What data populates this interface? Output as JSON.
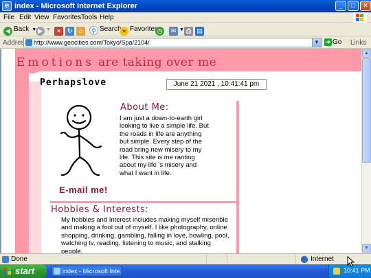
{
  "window": {
    "title": "index - Microsoft Internet Explorer",
    "app_icon": "e",
    "controls": {
      "minimize": "_",
      "maximize": "□",
      "close": "×"
    }
  },
  "menu": [
    "File",
    "Edit",
    "View",
    "Favorites",
    "Tools",
    "Help"
  ],
  "toolbar": {
    "back_label": "Back",
    "search_label": "Search",
    "favorites_label": "Favorites"
  },
  "address": {
    "label": "Address",
    "url": "http://www.geocities.com/Tokyo/Spa/2104/",
    "go_label": "Go",
    "links_label": "Links"
  },
  "page": {
    "headline_spaced": "Emotions",
    "headline_rest": "are taking over me",
    "site_name": "Perhapslove",
    "datetime": "June 21 2021 , 10:41:41 pm",
    "email_label": "E-mail me!",
    "about": {
      "title": "About Me:",
      "text": "I am just a down-to-earth girl looking to live a simple life. But the roads in life are anything but simple.  Every step of the road bring new misery to my life. This site is me ranting about my life 's misery and what I want in life."
    },
    "hobbies": {
      "title": "Hobbies & Interests:",
      "text": "My hobbies and Interest includes making myself miserible and making a fool out of myself. I like photography, online shopping, drinking, gambling, falling in love, bowling, pool, watching tv, reading, listening to music, and stalking people."
    }
  },
  "status": {
    "text": "Done",
    "zone": "Internet"
  },
  "taskbar": {
    "start_label": "start",
    "task_label": "index - Microsoft Inte...",
    "clock": "10:41 PM"
  },
  "colors": {
    "accent_pink": "#ff99aa",
    "heading_red": "#8b1a2a",
    "headline_red": "#cc2244"
  }
}
